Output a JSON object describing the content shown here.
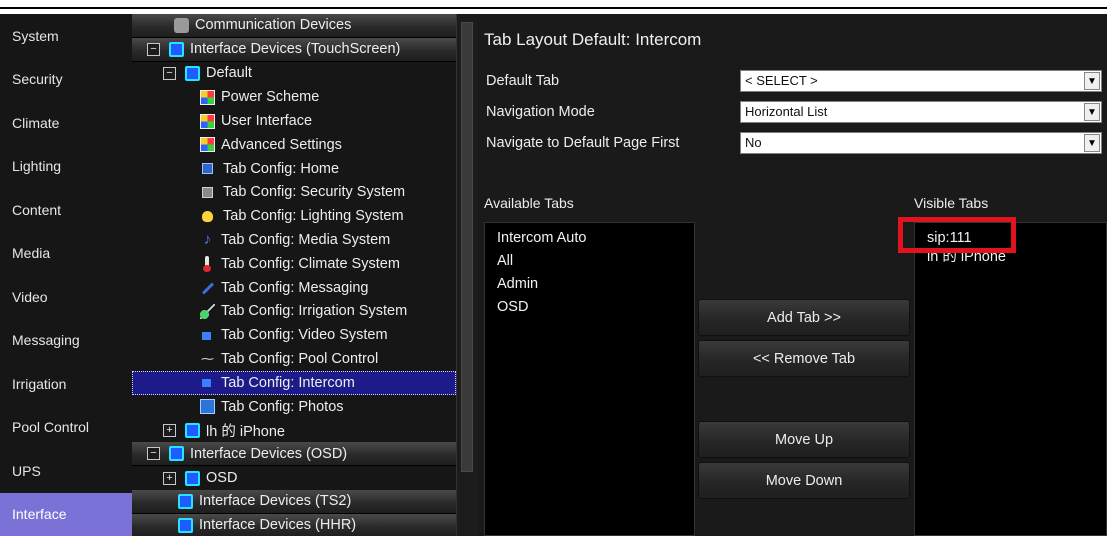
{
  "nav": {
    "items": [
      {
        "label": "System"
      },
      {
        "label": "Security"
      },
      {
        "label": "Climate"
      },
      {
        "label": "Lighting"
      },
      {
        "label": "Content"
      },
      {
        "label": "Media"
      },
      {
        "label": "Video"
      },
      {
        "label": "Messaging"
      },
      {
        "label": "Irrigation"
      },
      {
        "label": "Pool Control"
      },
      {
        "label": "UPS"
      },
      {
        "label": "Interface"
      }
    ],
    "active": "Interface"
  },
  "tree": {
    "rows": [
      {
        "label": "Communication Devices"
      },
      {
        "label": "Interface Devices (TouchScreen)",
        "expander": "−"
      },
      {
        "label": "Default",
        "expander": "−"
      },
      {
        "label": "Power Scheme"
      },
      {
        "label": "User Interface"
      },
      {
        "label": "Advanced Settings"
      },
      {
        "label": "Tab Config: Home"
      },
      {
        "label": "Tab Config: Security System"
      },
      {
        "label": "Tab Config: Lighting System"
      },
      {
        "label": "Tab Config: Media System"
      },
      {
        "label": "Tab Config: Climate System"
      },
      {
        "label": "Tab Config: Messaging"
      },
      {
        "label": "Tab Config: Irrigation System"
      },
      {
        "label": "Tab Config: Video System"
      },
      {
        "label": "Tab Config: Pool Control"
      },
      {
        "label": "Tab Config: Intercom"
      },
      {
        "label": "Tab Config: Photos"
      },
      {
        "label": "lh 的 iPhone",
        "expander": "+"
      },
      {
        "label": "Interface Devices (OSD)",
        "expander": "−"
      },
      {
        "label": "OSD",
        "expander": "+"
      },
      {
        "label": "Interface Devices (TS2)"
      },
      {
        "label": "Interface Devices (HHR)"
      }
    ],
    "selected": "Tab Config: Intercom"
  },
  "panel": {
    "title": "Tab Layout Default: Intercom",
    "default_tab": {
      "label": "Default Tab",
      "value": "< SELECT >"
    },
    "navigation_mode": {
      "label": "Navigation Mode",
      "value": "Horizontal List"
    },
    "navigate_first": {
      "label": "Navigate to Default Page First",
      "value": "No"
    },
    "available": {
      "label": "Available Tabs",
      "items": [
        "Intercom Auto",
        "All",
        "Admin",
        "OSD"
      ]
    },
    "visible": {
      "label": "Visible Tabs",
      "items": [
        "sip:111",
        "lh 的 iPhone"
      ]
    },
    "buttons": {
      "add": "Add Tab >>",
      "remove": "<< Remove Tab",
      "move_up": "Move Up",
      "move_down": "Move Down"
    },
    "highlight_color": "#e3121f"
  }
}
